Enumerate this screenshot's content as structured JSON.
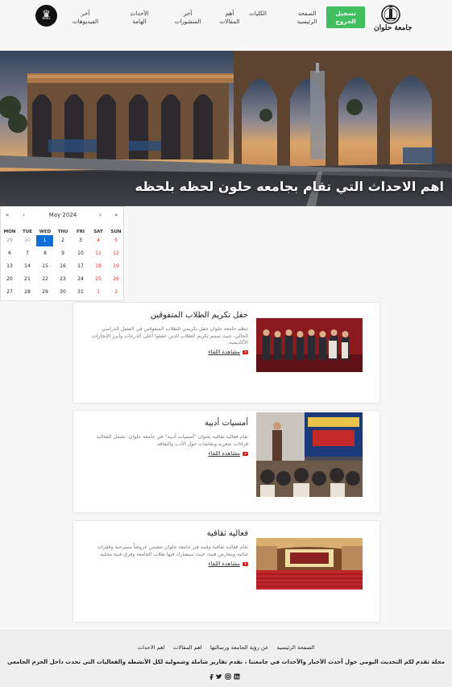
{
  "header": {
    "logo_text": "جامعة حلوان",
    "logout_label": "تسجيل\nالخروج",
    "nav": [
      {
        "label": "الصفحة\nالرئيسية"
      },
      {
        "label": "الكليات"
      },
      {
        "label": "أهم\nالمقالات"
      },
      {
        "label": "آخر\nالمنشورات"
      },
      {
        "label": "الأحداث\nالهامة"
      },
      {
        "label": "آخر\nالفيديوهات"
      }
    ],
    "profile_icon": "crown-icon"
  },
  "hero": {
    "title": "اهم الاحداث التي تقام بجامعه حلون لحظه بلحظه"
  },
  "calendar": {
    "month_label": "May 2024",
    "prev_year": "«",
    "prev_month": "‹",
    "next_month": "›",
    "next_year": "»",
    "weekdays": [
      "MON",
      "TUE",
      "WED",
      "THU",
      "FRI",
      "SAT",
      "SUN"
    ],
    "weeks": [
      [
        "29",
        "30",
        "1",
        "2",
        "3",
        "4",
        "5"
      ],
      [
        "6",
        "7",
        "8",
        "9",
        "10",
        "11",
        "12"
      ],
      [
        "13",
        "14",
        "15",
        "16",
        "17",
        "18",
        "19"
      ],
      [
        "20",
        "21",
        "22",
        "23",
        "24",
        "25",
        "26"
      ],
      [
        "27",
        "28",
        "29",
        "30",
        "31",
        "1",
        "2"
      ]
    ],
    "selected_day": "1",
    "weekend_color": "#e2302a",
    "selected_color": "#0d6fd8"
  },
  "events": [
    {
      "title": "حفل تكريم الطلاب المتفوقين",
      "description": "تنظم جامعة حلوان حفل تكريمي للطلاب المتفوقين في الفصل الدراسي الحالي، حيث سيتم تكريم الطلاب الذين حققوا أعلى الدرجات وأبرز الإنجازات الأكاديمية.",
      "link": "مشاهدة اللقاء"
    },
    {
      "title": "أمسيات أدبية",
      "description": "تقام فعالية ثقافية بعنوان \"أمسيات أدبية\" في جامعة حلوان، تشمل الفعالية قراءات شعرية ونقاشات حول الأدب والثقافة.",
      "link": "مشاهدة اللقاء"
    },
    {
      "title": "فعالية ثقافية",
      "description": "تقام فعالية ثقافية وفنية في جامعة حلوان تتضمن عروضاً مسرحية وفقرات غنائية ومعارض فنية، حيث سيشارك فيها طلاب الجامعة وفرق فنية محلية.",
      "link": "مشاهدة اللقاء"
    }
  ],
  "footer": {
    "links": [
      "الصفحة الرئيسية",
      "عن رؤية الجامعة ورسالتها",
      "اهم المقالات",
      "اهم الاحداث"
    ],
    "tagline": "مجلة تقدم لكم التحديث اليومي حول أحدث الأخبار والأحداث في جامعتنا ، نقدم تقارير شاملة وشمولية لكل الأنشطة والفعاليات التي تحدث داخل الحرم الجامعي",
    "social_icons": [
      "facebook-icon",
      "twitter-icon",
      "instagram-icon",
      "linkedin-icon"
    ]
  },
  "colors": {
    "logout_green": "#3fbf5d",
    "youtube_red": "#e01e1e"
  }
}
